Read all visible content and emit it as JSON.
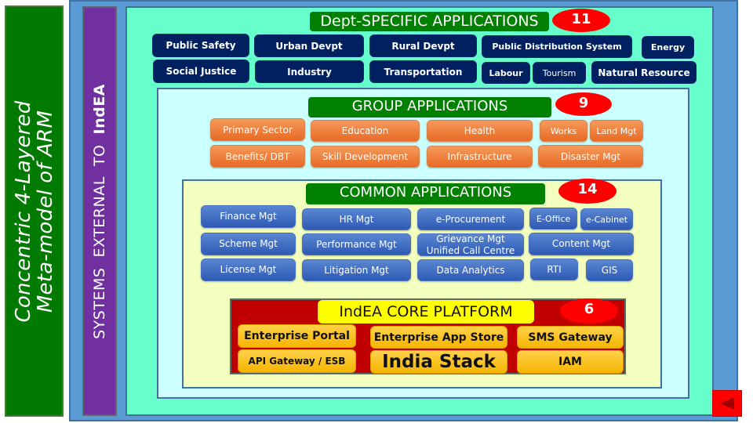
{
  "title": {
    "line1": "Concentric 4-Layered",
    "line2": "Meta-model of ARM"
  },
  "external_systems": {
    "prefix": "SYSTEMS  EXTERNAL  TO  ",
    "bold": "IndEA"
  },
  "dept_specific": {
    "label": "Dept-SPECIFIC APPLICATIONS",
    "count": "11",
    "items": [
      "Public Safety",
      "Urban Devpt",
      "Rural Devpt",
      "Public Distribution System",
      "Energy",
      "Social Justice",
      "Industry",
      "Transportation",
      "Labour",
      "Tourism",
      "Natural Resource"
    ]
  },
  "group": {
    "label": "GROUP APPLICATIONS",
    "count": "9",
    "items": [
      "Primary  Sector",
      "Education",
      "Health",
      "Works",
      "Land Mgt",
      "Benefits/ DBT",
      "Skill Development",
      "Infrastructure",
      "Disaster Mgt"
    ]
  },
  "common": {
    "label": "COMMON APPLICATIONS",
    "count": "14",
    "items": [
      "Finance Mgt",
      "HR Mgt",
      "e-Procurement",
      "E-Office",
      "e-Cabinet",
      "Scheme Mgt",
      "Performance Mgt",
      "Grievance Mgt",
      "Unified Call Centre",
      "Content Mgt",
      "License Mgt",
      "Litigation Mgt",
      "Data Analytics",
      "RTI",
      "GIS"
    ]
  },
  "core": {
    "label": "IndEA CORE PLATFORM",
    "count": "6",
    "items": [
      "Enterprise Portal",
      "Enterprise App Store",
      "SMS Gateway",
      "API Gateway / ESB",
      "India Stack",
      "IAM"
    ]
  },
  "colors": {
    "title_green": "#007a00",
    "outer_blue": "#5b9bd5",
    "purple": "#7030a0",
    "dept_teal": "#66ffcc",
    "group_cyan": "#ccffff",
    "common_yellow": "#f2ffbf",
    "core_red": "#c00000",
    "banner_green": "#008000",
    "count_red": "#ff0000",
    "navy": "#002060",
    "orange": "#ed7d31",
    "blue": "#4472c4",
    "gold": "#ffc000"
  },
  "nav": {
    "back_icon": "back-triangle-icon"
  }
}
